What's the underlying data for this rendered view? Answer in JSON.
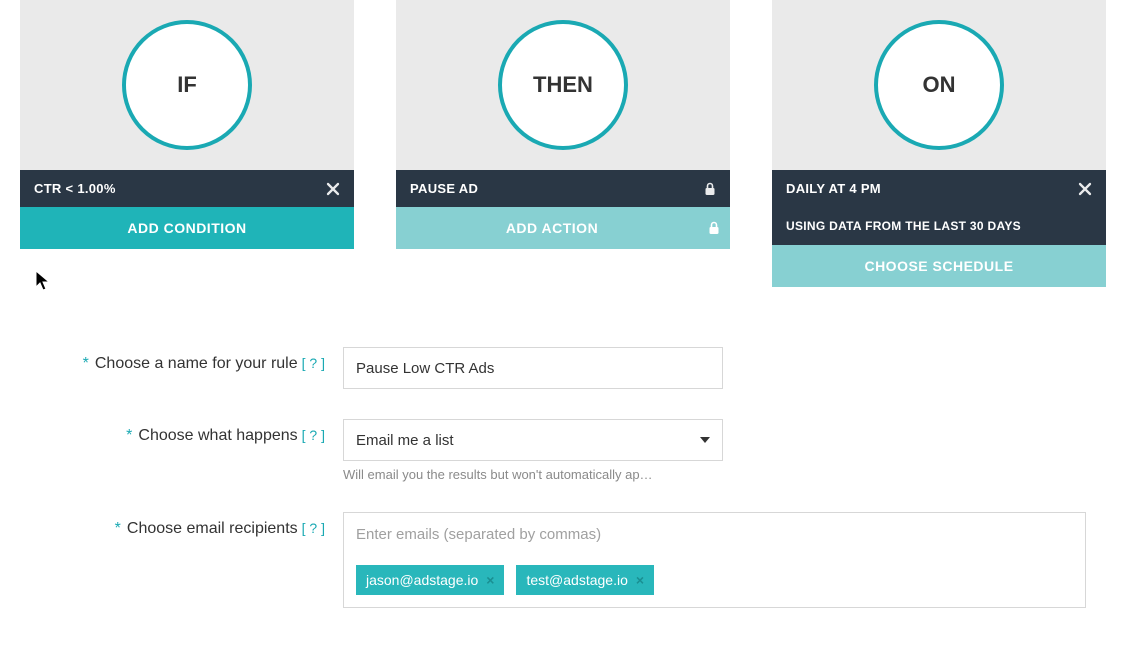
{
  "cards": {
    "if": {
      "title": "IF",
      "condition": "CTR < 1.00%",
      "btn": "ADD CONDITION"
    },
    "then": {
      "title": "THEN",
      "action": "PAUSE AD",
      "btn": "ADD ACTION"
    },
    "on": {
      "title": "ON",
      "line1": "DAILY AT 4 PM",
      "line2": "USING DATA FROM THE LAST 30 DAYS",
      "btn": "CHOOSE SCHEDULE"
    }
  },
  "form": {
    "name_label": "Choose a name for your rule",
    "name_value": "Pause Low CTR Ads",
    "happens_label": "Choose what happens",
    "happens_value": "Email me a list",
    "happens_sub": "Will email you the results but won't automatically ap…",
    "recipients_label": "Choose email recipients",
    "recipients_placeholder": "Enter emails (separated by commas)",
    "recipients": [
      "jason@adstage.io",
      "test@adstage.io"
    ],
    "hint": "[ ? ]"
  }
}
